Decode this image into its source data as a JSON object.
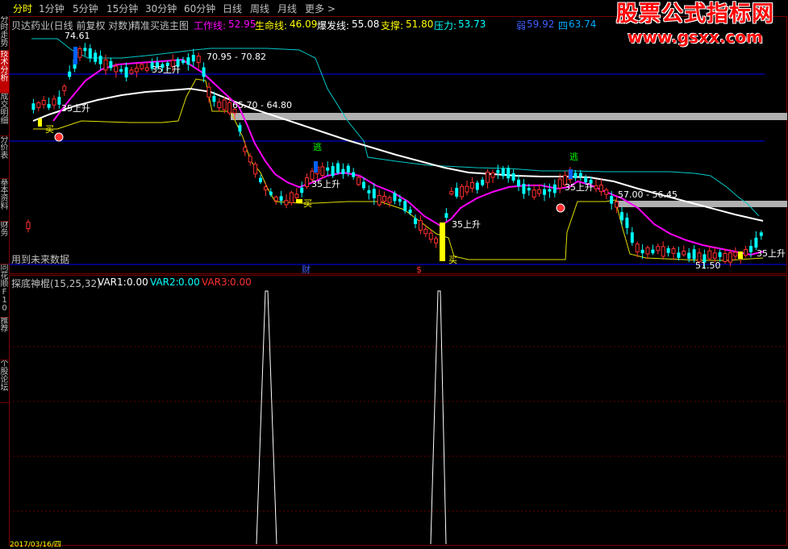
{
  "toolbar": {
    "items": [
      "分时",
      "1分钟",
      "5分钟",
      "15分钟",
      "30分钟",
      "60分钟",
      "日线",
      "周线",
      "月线",
      "更多 >"
    ],
    "active": "分时"
  },
  "sidebar": {
    "items": [
      "分时走势",
      "技术分析",
      "成交明细",
      "分价表",
      "基本资料",
      "财务",
      "同花顺F10",
      "推荐",
      "个股论坛"
    ]
  },
  "main_info": {
    "title": "贝达药业(日线 前复权 对数)",
    "indicator_name": "精准买逃主图",
    "work_label": "工作线:",
    "work_value": "52.95",
    "life_label": "生命线:",
    "life_value": "46.09",
    "burst_label": "爆发线:",
    "burst_value": "55.08",
    "support_label": "支撑:",
    "support_value": "51.80",
    "pressure_label": "压力:",
    "pressure_value": "53.73",
    "r1_label": "弱",
    "r1_value": "59.92",
    "r2_label": "四",
    "r2_value": "63.74"
  },
  "watermark": {
    "title": "股票公式指标网",
    "url": "www.gsxx.com"
  },
  "main_chart": {
    "high_label": "74.61",
    "range_labels": [
      "70.95 - 70.82",
      "65.70 - 64.80",
      "57.00 - 56.45"
    ],
    "low_label": "51.50",
    "signals": {
      "rise": [
        "35上升",
        "35上升",
        "35上升",
        "35上升",
        "35上升",
        "35上升"
      ],
      "buy": [
        "买",
        "买",
        "买"
      ],
      "escape": [
        "逃",
        "逃"
      ],
      "future_note": "用到未来数据",
      "fin_marker": "财",
      "div_marker": "$"
    }
  },
  "sub_chart": {
    "name": "探底神棍(15,25,32)",
    "var1_label": "VAR1:",
    "var1_value": "0.00",
    "var2_label": "VAR2:",
    "var2_value": "0.00",
    "var3_label": "VAR3:",
    "var3_value": "0.00"
  },
  "footer": {
    "date": "2017/03/16/四"
  },
  "colors": {
    "up": "#ff3030",
    "down": "#00ffff",
    "purple": "#ff00ff",
    "white_line": "#ffffff",
    "yellow": "#ffff00",
    "pressure": "#00ffff",
    "blue_line": "#0000ff"
  }
}
